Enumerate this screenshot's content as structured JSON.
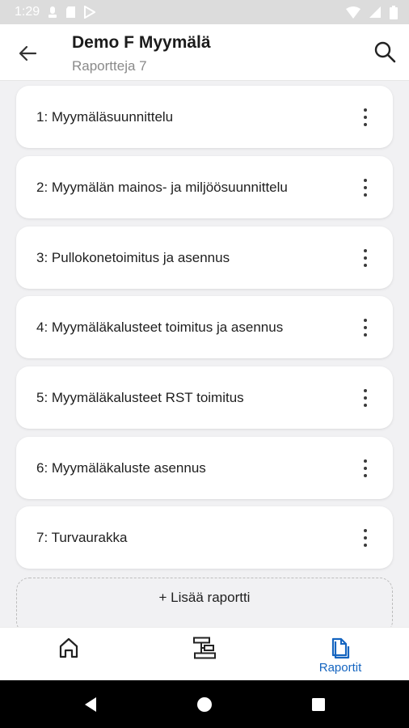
{
  "status_bar": {
    "time": "1:29"
  },
  "app_bar": {
    "title": "Demo F Myymälä",
    "subtitle": "Raportteja 7"
  },
  "reports": [
    {
      "label": "1: Myymäläsuunnittelu"
    },
    {
      "label": "2: Myymälän mainos- ja miljöösuunnittelu"
    },
    {
      "label": "3: Pullokonetoimitus ja asennus"
    },
    {
      "label": "4: Myymäläkalusteet toimitus ja asennus"
    },
    {
      "label": "5: Myymäläkalusteet RST toimitus"
    },
    {
      "label": "6: Myymäläkaluste asennus"
    },
    {
      "label": "7: Turvaurakka"
    }
  ],
  "add_report": {
    "label": "+ Lisää raportti"
  },
  "bottom_nav": {
    "items": [
      {
        "icon": "home-icon",
        "label": ""
      },
      {
        "icon": "list-icon",
        "label": ""
      },
      {
        "icon": "reports-icon",
        "label": "Raportit",
        "active": true
      }
    ]
  },
  "colors": {
    "accent": "#1565c0",
    "background": "#f1f1f3",
    "card": "#ffffff",
    "status_bar": "#dcdcdc"
  }
}
